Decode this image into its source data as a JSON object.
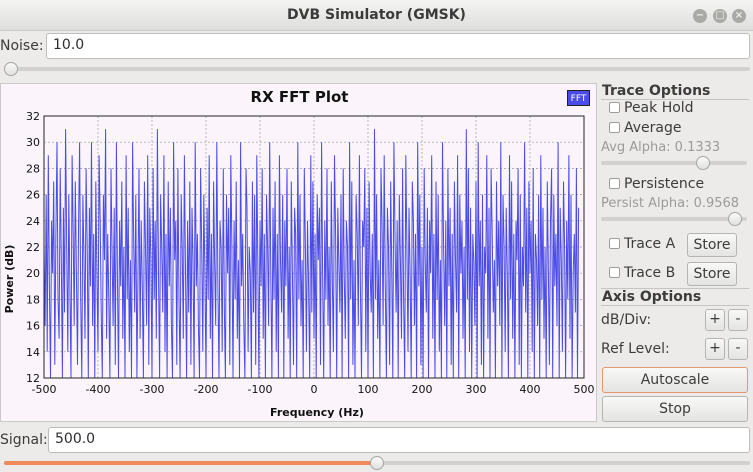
{
  "window": {
    "title": "DVB Simulator (GMSK)",
    "controls": [
      "−",
      "□",
      "×"
    ]
  },
  "noise": {
    "label": "Noise:",
    "value": "10.0",
    "slider_fraction": 0.0
  },
  "signal": {
    "label": "Signal:",
    "value": "500.0",
    "slider_fraction": 0.5
  },
  "plot": {
    "title": "RX FFT Plot",
    "legend": "FFT",
    "series_color": "#4b4be8",
    "ylabel": "Power (dB)",
    "xlabel": "Frequency (Hz)"
  },
  "chart_data": {
    "type": "line",
    "title": "RX FFT Plot",
    "xlabel": "Frequency (Hz)",
    "ylabel": "Power (dB)",
    "xlim": [
      -500,
      500
    ],
    "ylim": [
      12,
      32
    ],
    "xticks": [
      -500,
      -400,
      -300,
      -200,
      -100,
      0,
      100,
      200,
      300,
      400,
      500
    ],
    "yticks": [
      12,
      14,
      16,
      18,
      20,
      22,
      24,
      26,
      28,
      30,
      32
    ],
    "grid": true,
    "legend_position": "top-right",
    "series": [
      {
        "name": "FFT",
        "color": "#4b4be8",
        "x_start": -500,
        "x_step": 2,
        "values": [
          22,
          16,
          26,
          14,
          29,
          19,
          12,
          24,
          20,
          27,
          13,
          23,
          30,
          18,
          15,
          28,
          21,
          12,
          25,
          17,
          31,
          22,
          14,
          26,
          19,
          12,
          29,
          23,
          16,
          27,
          20,
          13,
          24,
          30,
          18,
          12,
          26,
          21,
          15,
          28,
          22,
          12,
          25,
          19,
          30,
          16,
          23,
          12,
          27,
          20,
          14,
          29,
          24,
          17,
          12,
          26,
          21,
          31,
          15,
          23,
          18,
          12,
          28,
          22,
          16,
          25,
          13,
          30,
          20,
          12,
          24,
          19,
          27,
          15,
          22,
          12,
          29,
          18,
          25,
          14,
          21,
          12,
          30,
          23,
          17,
          26,
          12,
          20,
          28,
          15,
          24,
          19,
          12,
          27,
          22,
          16,
          29,
          13,
          25,
          21,
          12,
          28,
          18,
          24,
          15,
          31,
          20,
          12,
          26,
          22,
          17,
          29,
          14,
          23,
          12,
          27,
          19,
          25,
          16,
          12,
          30,
          21,
          24,
          13,
          28,
          18,
          12,
          26,
          22,
          15,
          29,
          20,
          12,
          24,
          17,
          27,
          13,
          25,
          21,
          12,
          30,
          19,
          23,
          16,
          12,
          28,
          22,
          14,
          26,
          20,
          12,
          25,
          18,
          29,
          15,
          23,
          12,
          27,
          21,
          16,
          30,
          19,
          12,
          24,
          22,
          14,
          28,
          17,
          12,
          26,
          20,
          25,
          13,
          29,
          22,
          12,
          24,
          18,
          27,
          15,
          21,
          12,
          30,
          19,
          23,
          16,
          12,
          28,
          25,
          14,
          22,
          20,
          12,
          27,
          17,
          26,
          13,
          29,
          21,
          12,
          24,
          19,
          28,
          15,
          23,
          12,
          26,
          22,
          16,
          30,
          20,
          12,
          25,
          18,
          27,
          14,
          23,
          12,
          29,
          21,
          17,
          26,
          12,
          24,
          19,
          28,
          15,
          22,
          12,
          27,
          20,
          13,
          25,
          23,
          12,
          30,
          18,
          26,
          16,
          21,
          12,
          28,
          22,
          14,
          24,
          19,
          12,
          29,
          17,
          27,
          15,
          23,
          12,
          26,
          21,
          25,
          13,
          30,
          20,
          12,
          24,
          18,
          28,
          16,
          22,
          12,
          27,
          19,
          14,
          29,
          23,
          12,
          25,
          21,
          17,
          26,
          12,
          28,
          20,
          15,
          24,
          22,
          12,
          30,
          18,
          27,
          13,
          21,
          12,
          26,
          23,
          16,
          29,
          19,
          12,
          24,
          22,
          28,
          14,
          25,
          12,
          27,
          20,
          17,
          23,
          12,
          31,
          18,
          26,
          15,
          21,
          12,
          28,
          24,
          16,
          29,
          19,
          12,
          25,
          22,
          13,
          27,
          20,
          12,
          30,
          23,
          17,
          24,
          12,
          26,
          21,
          15,
          28,
          18,
          12,
          29,
          22,
          14,
          25,
          20,
          12,
          27,
          24,
          16,
          23,
          12,
          30,
          19,
          26,
          13,
          22,
          12,
          28,
          21,
          17,
          25,
          12,
          24,
          20,
          29,
          15,
          23,
          12,
          27,
          18,
          26,
          14,
          21,
          12,
          30,
          22,
          16,
          24,
          12,
          28,
          19,
          25,
          13,
          23,
          12,
          27,
          21,
          17,
          29,
          12,
          26,
          20,
          24,
          15,
          22,
          12,
          31,
          18,
          28,
          14,
          25,
          12,
          23,
          21,
          16,
          27,
          12,
          30,
          19,
          24,
          13,
          26,
          12,
          22,
          20,
          29,
          15,
          25,
          12,
          28,
          23,
          17,
          21,
          12,
          27,
          19,
          24,
          16,
          30,
          12,
          26,
          22,
          14,
          25,
          20,
          12,
          29,
          18,
          27,
          15,
          23,
          12,
          24,
          21,
          28,
          13,
          26,
          12,
          22,
          19,
          30,
          17,
          25,
          12,
          27,
          20,
          24,
          14,
          28,
          12,
          23,
          21,
          16,
          26,
          12,
          29,
          18,
          25,
          15,
          22,
          12,
          27,
          20,
          13,
          24,
          28,
          12,
          26,
          19,
          23,
          16,
          30,
          12,
          25,
          21,
          14,
          27,
          22,
          12,
          24,
          18,
          29,
          15,
          26,
          12,
          20,
          23,
          17,
          28,
          12,
          25
        ]
      }
    ]
  },
  "trace_options": {
    "title": "Trace Options",
    "peak_hold": "Peak Hold",
    "average": "Average",
    "avg_alpha": "Avg Alpha: 0.1333",
    "avg_alpha_fraction": 0.72,
    "persistence": "Persistence",
    "persist_alpha": "Persist Alpha: 0.9568",
    "persist_alpha_fraction": 0.96,
    "trace_a": "Trace A",
    "trace_b": "Trace B",
    "store": "Store"
  },
  "axis_options": {
    "title": "Axis Options",
    "db_div": "dB/Div:",
    "ref_level": "Ref Level:",
    "plus": "+",
    "minus": "-",
    "autoscale": "Autoscale",
    "stop": "Stop"
  }
}
